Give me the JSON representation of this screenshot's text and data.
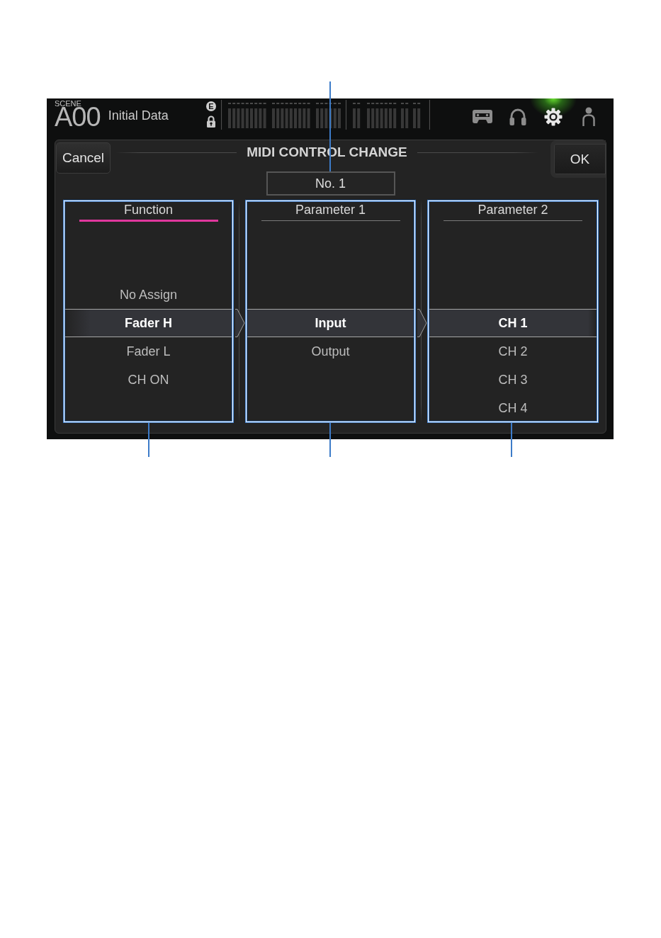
{
  "top_bar": {
    "scene_label": "SCENE",
    "scene_number": "A00",
    "scene_name": "Initial Data",
    "badge": "E",
    "locked": true,
    "tools": [
      {
        "kind": "cassette",
        "lit": false
      },
      {
        "kind": "headphones",
        "lit": false
      },
      {
        "kind": "gear",
        "lit": true
      },
      {
        "kind": "person",
        "lit": false
      }
    ]
  },
  "dialog": {
    "cancel_button": "Cancel",
    "title": "MIDI CONTROL CHANGE",
    "ok_button": "OK",
    "number": "No. 1",
    "columns": [
      {
        "title": "Function",
        "active": true,
        "items": [
          {
            "label": "No Assign",
            "selected": false
          },
          {
            "label": "Fader H",
            "selected": true
          },
          {
            "label": "Fader L",
            "selected": false
          },
          {
            "label": "CH ON",
            "selected": false
          }
        ]
      },
      {
        "title": "Parameter 1",
        "active": false,
        "items": [
          {
            "label": "Input",
            "selected": true
          },
          {
            "label": "Output",
            "selected": false
          }
        ]
      },
      {
        "title": "Parameter 2",
        "active": false,
        "items": [
          {
            "label": "CH 1",
            "selected": true
          },
          {
            "label": "CH 2",
            "selected": false
          },
          {
            "label": "CH 3",
            "selected": false
          },
          {
            "label": "CH 4",
            "selected": false
          }
        ]
      }
    ]
  }
}
